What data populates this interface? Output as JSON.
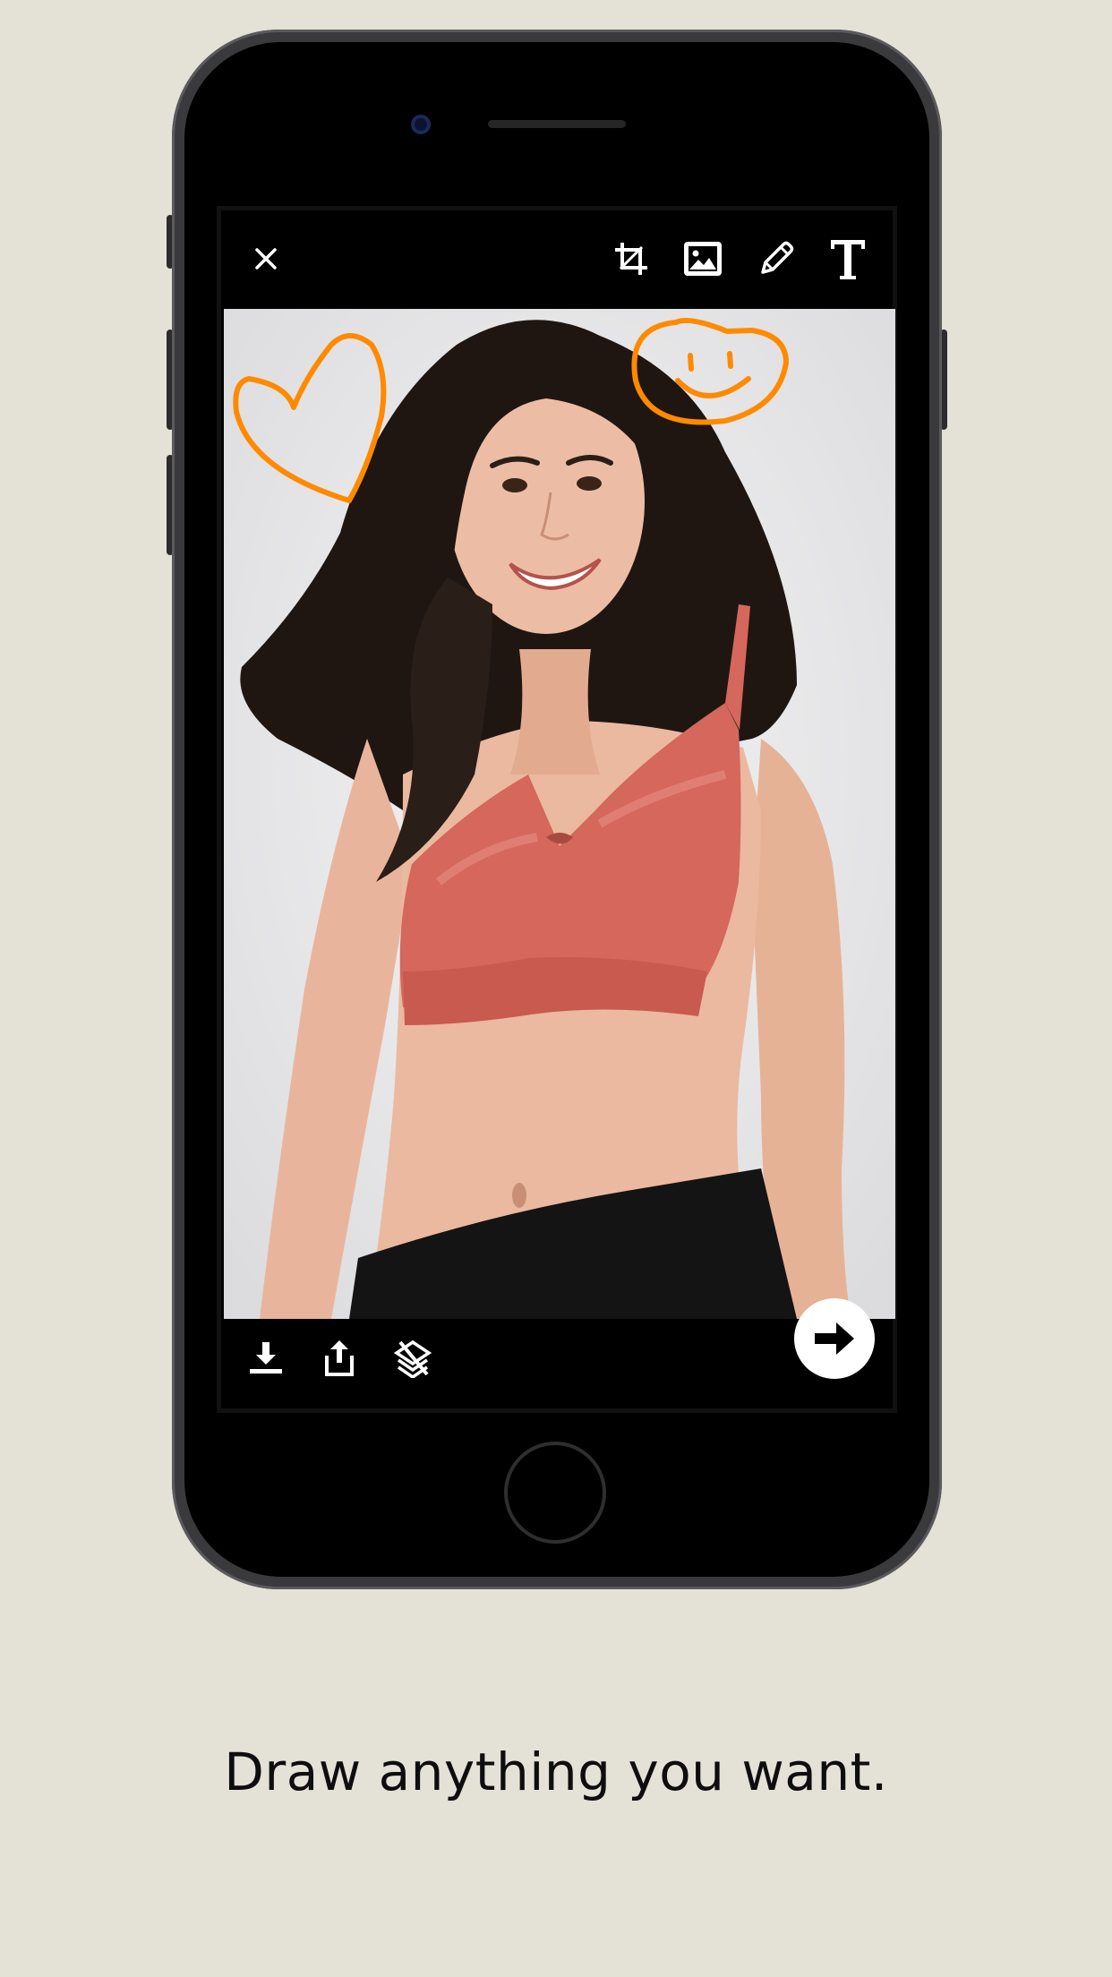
{
  "caption": {
    "text": "Draw anything you want."
  },
  "editor": {
    "top_toolbar": {
      "close_icon": "close-icon",
      "crop_icon": "crop-icon",
      "image_icon": "image-icon",
      "pencil_icon": "pencil-icon",
      "text_icon": "text-icon"
    },
    "bottom_toolbar": {
      "download_icon": "download-icon",
      "share_icon": "share-icon",
      "layers_off_icon": "layers-off-icon",
      "next_icon": "arrow-right-icon"
    },
    "drawing": {
      "stroke_color": "#ff8a00",
      "shapes": [
        "heart",
        "smiley"
      ]
    }
  },
  "colors": {
    "background": "#e4e2d7",
    "phone": "#3a3a3c",
    "accent": "#ff8a00"
  }
}
